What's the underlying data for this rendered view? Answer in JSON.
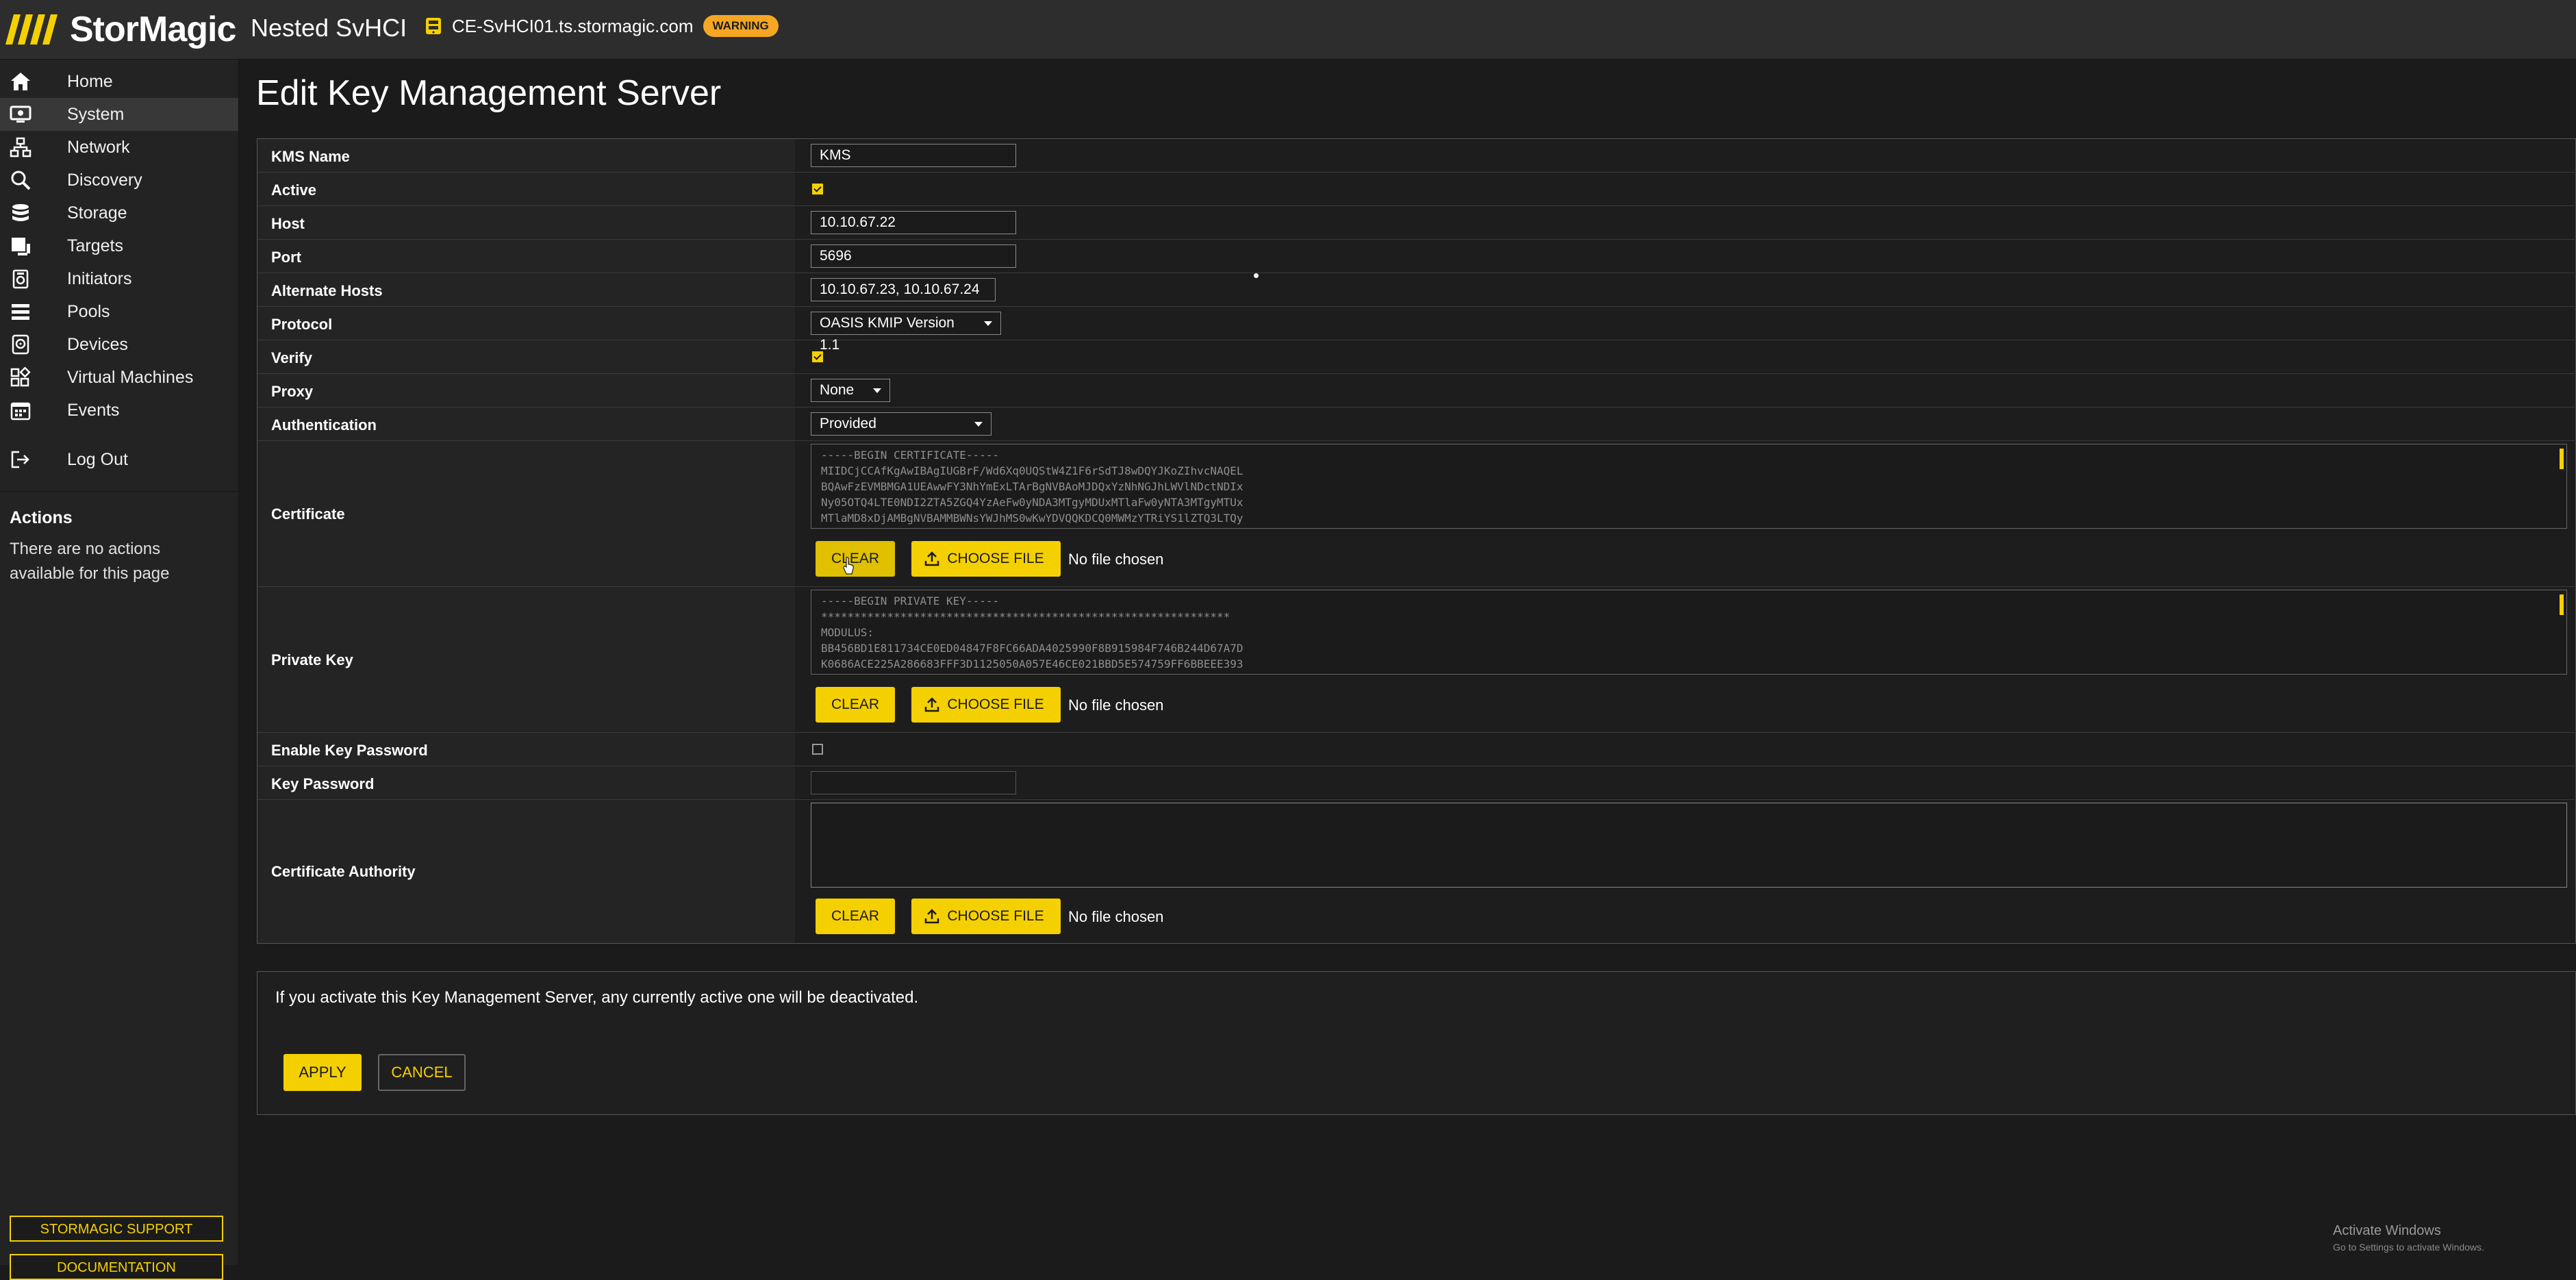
{
  "header": {
    "logo_text": "StorMagic",
    "app_title": "Nested SvHCI",
    "host": "CE-SvHCI01.ts.stormagic.com",
    "status_badge": "WARNING"
  },
  "sidebar": {
    "items": [
      {
        "label": "Home",
        "icon": "home-icon"
      },
      {
        "label": "System",
        "icon": "system-icon"
      },
      {
        "label": "Network",
        "icon": "network-icon"
      },
      {
        "label": "Discovery",
        "icon": "discovery-icon"
      },
      {
        "label": "Storage",
        "icon": "storage-icon"
      },
      {
        "label": "Targets",
        "icon": "targets-icon"
      },
      {
        "label": "Initiators",
        "icon": "initiators-icon"
      },
      {
        "label": "Pools",
        "icon": "pools-icon"
      },
      {
        "label": "Devices",
        "icon": "devices-icon"
      },
      {
        "label": "Virtual Machines",
        "icon": "virtual-machines-icon"
      },
      {
        "label": "Events",
        "icon": "events-icon"
      }
    ],
    "logout_label": "Log Out",
    "actions_title": "Actions",
    "actions_text": "There are no actions available for this page",
    "support_button": "STORMAGIC SUPPORT",
    "documentation_button": "DOCUMENTATION"
  },
  "page": {
    "title": "Edit Key Management Server"
  },
  "form": {
    "kms_name_label": "KMS Name",
    "kms_name_value": "KMS",
    "active_label": "Active",
    "active_checked": true,
    "host_label": "Host",
    "host_value": "10.10.67.22",
    "port_label": "Port",
    "port_value": "5696",
    "alternate_hosts_label": "Alternate Hosts",
    "alternate_hosts_value": "10.10.67.23, 10.10.67.24",
    "protocol_label": "Protocol",
    "protocol_value": "OASIS KMIP Version 1.1",
    "verify_label": "Verify",
    "verify_checked": true,
    "proxy_label": "Proxy",
    "proxy_value": "None",
    "authentication_label": "Authentication",
    "authentication_value": "Provided",
    "certificate_label": "Certificate",
    "certificate_lines": [
      "-----BEGIN CERTIFICATE-----",
      "MIIDCjCCAfKgAwIBAgIUGBrF/Wd6Xq0UQStW4Z1F6rSdTJ8wDQYJKoZIhvcNAQEL",
      "BQAwFzEVMBMGA1UEAwwFY3NhYmExLTArBgNVBAoMJDQxYzNhNGJhLWVlNDctNDIx",
      "Ny05OTQ4LTE0NDI2ZTA5ZGQ4YzAeFw0yNDA3MTgyMDUxMTlaFw0yNTA3MTgyMTUx",
      "MTlaMD8xDjAMBgNVBAMMBWNsYWJhMS0wKwYDVQQKDCQ0MWMzYTRiYS1lZTQ3LTQy"
    ],
    "private_key_label": "Private Key",
    "private_key_lines": [
      "-----BEGIN PRIVATE KEY-----",
      "**************************************************************",
      "MODULUS:",
      "BB456BD1E811734CE0ED04847F8FC66ADA4025990F8B915984F746B244D67A7D",
      "K0686ACE225A286683FFF3D1125050A057E46CE021BBD5E574759FF6BBEEE393"
    ],
    "enable_key_password_label": "Enable Key Password",
    "enable_key_password_checked": false,
    "key_password_label": "Key Password",
    "key_password_value": "",
    "certificate_authority_label": "Certificate Authority",
    "certificate_authority_value": "",
    "clear_label": "CLEAR",
    "choose_file_label": "CHOOSE FILE",
    "no_file_text": "No file chosen"
  },
  "info": {
    "message": "If you activate this Key Management Server, any currently active one will be deactivated.",
    "apply_label": "APPLY",
    "cancel_label": "CANCEL"
  },
  "watermark": {
    "title": "Activate Windows",
    "subtitle": "Go to Settings to activate Windows."
  },
  "colors": {
    "accent": "#f5d000",
    "warning": "#f5a623",
    "background": "#1b1b1b",
    "sidebar": "#232323"
  }
}
